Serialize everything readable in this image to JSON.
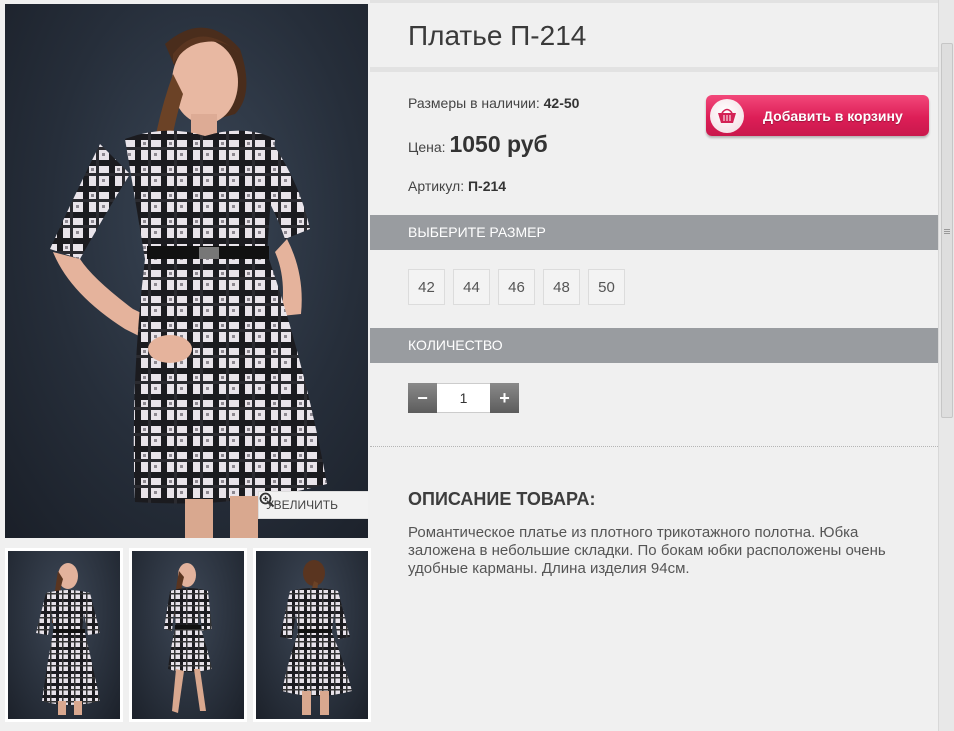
{
  "product": {
    "title": "Платье П-214",
    "sizes_label": "Размеры в наличии:",
    "sizes_value": "42-50",
    "price_label": "Цена:",
    "price_value": "1050 руб",
    "article_label": "Артикул:",
    "article_value": "П-214"
  },
  "gallery": {
    "zoom_label": "УВЕЛИЧИТЬ"
  },
  "cart": {
    "add_label": "Добавить в корзину"
  },
  "size_section": {
    "heading": "ВЫБЕРИТЕ РАЗМЕР",
    "options": [
      "42",
      "44",
      "46",
      "48",
      "50"
    ]
  },
  "quantity_section": {
    "heading": "КОЛИЧЕСТВО",
    "minus": "−",
    "plus": "+",
    "value": "1"
  },
  "description": {
    "heading": "ОПИСАНИЕ ТОВАРА:",
    "text": "Романтическое платье из плотного трикотажного полотна. Юбка заложена в небольшие складки. По бокам юбки расположены очень удобные карманы. Длина изделия 94см."
  },
  "colors": {
    "accent": "#dd1e57",
    "section_bar": "#999ca0",
    "background": "#f0f0f0"
  }
}
